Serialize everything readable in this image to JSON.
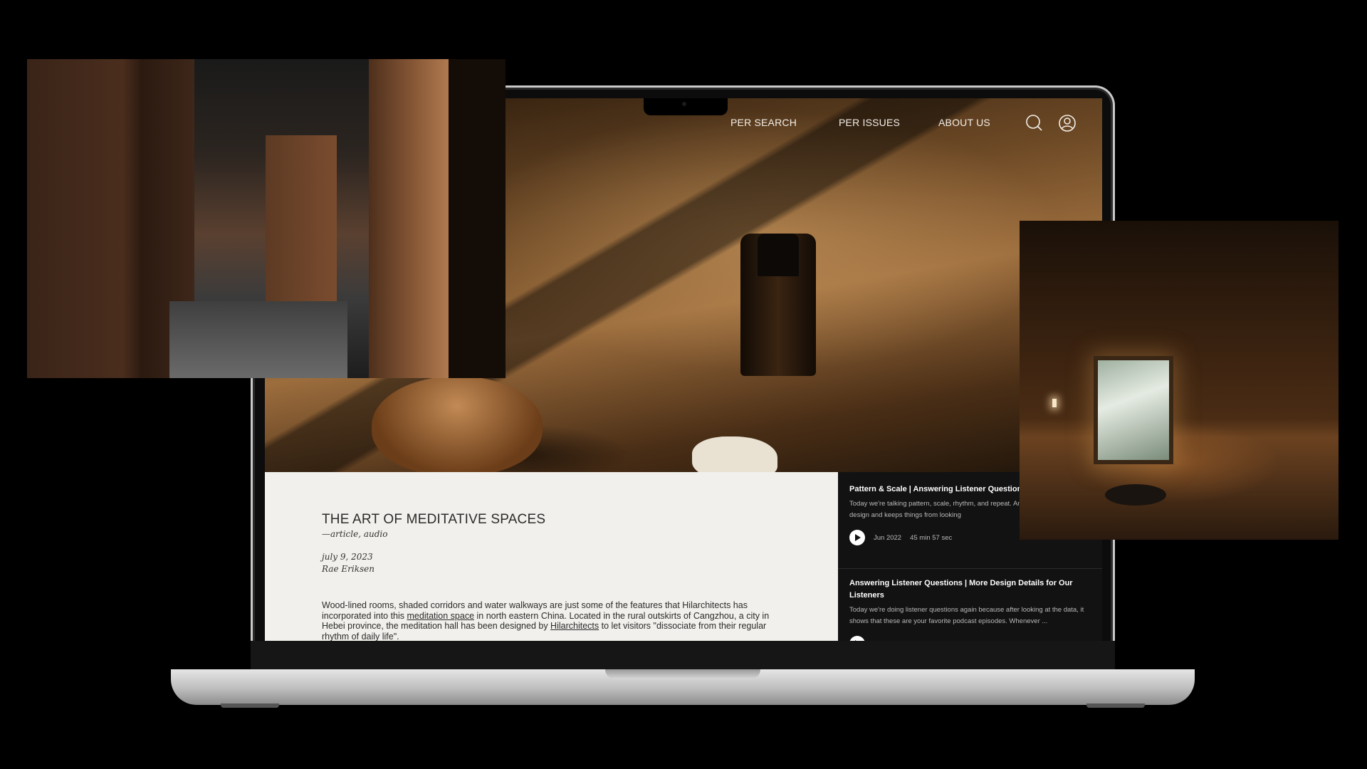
{
  "nav": {
    "links": [
      "PER SEARCH",
      "PER ISSUES",
      "ABOUT US"
    ],
    "icons": [
      "search-icon",
      "user-icon"
    ]
  },
  "article": {
    "title": "THE ART OF MEDITATIVE SPACES",
    "type": "—article, audio",
    "date": "july 9, 2023",
    "author": "Rae Eriksen",
    "body_1": "Wood-lined rooms, shaded corridors and water walkways are just some of the features that Hilarchitects has incorporated into this ",
    "link_1": "meditation space",
    "body_2": " in north eastern China. Located in the rural outskirts of Cangzhou, a city in Hebei province, the meditation hall has been designed by ",
    "link_2": "Hilarchitects",
    "body_3": " to let visitors \"dissociate from their regular rhythm of daily life\"."
  },
  "podcast": {
    "episodes": [
      {
        "title": "Pattern & Scale | Answering Listener Questions",
        "description": "Today we're talking pattern, scale, rhythm, and repeat. An important part of design and keeps things from looking",
        "date": "Jun 2022",
        "duration": "45 min 57 sec"
      },
      {
        "title": "Answering Listener Questions | More Design Details for Our Listeners",
        "description": "Today we're doing listener questions again because after looking at the data, it shows that these are your favorite podcast episodes. Whenever ..."
      }
    ]
  },
  "colors": {
    "article_bg": "#f1f0ec",
    "podcast_bg": "#121212",
    "page_bg": "#000000"
  }
}
